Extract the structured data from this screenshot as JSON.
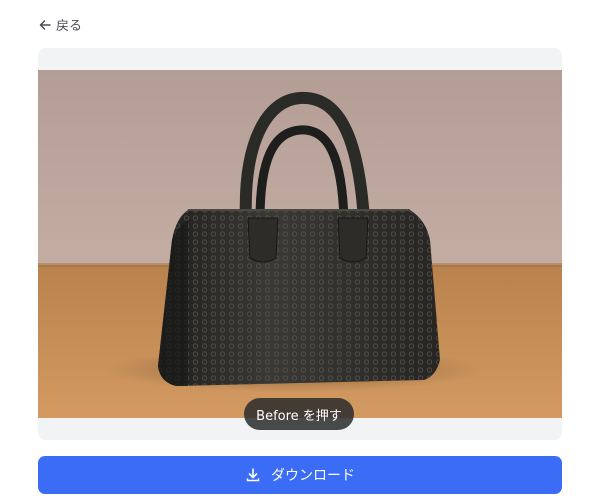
{
  "nav": {
    "back_label": "戻る"
  },
  "preview": {
    "before_label": "Before を押す"
  },
  "actions": {
    "download_label": "ダウンロード"
  },
  "colors": {
    "primary": "#3b6cf6",
    "pill": "#2c2c2c",
    "card_bg": "#f1f3f5"
  },
  "icons": {
    "back": "arrow-left-icon",
    "download": "download-icon"
  }
}
